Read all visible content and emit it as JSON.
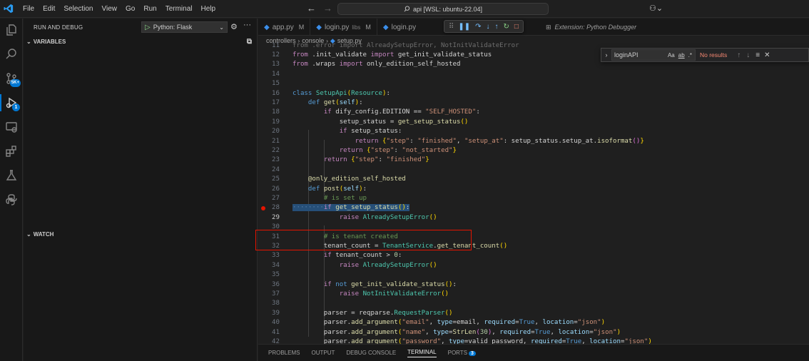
{
  "menu": [
    "File",
    "Edit",
    "Selection",
    "View",
    "Go",
    "Run",
    "Terminal",
    "Help"
  ],
  "command_center": "api [WSL: ubuntu-22.04]",
  "activity_badges": {
    "source_control": "5K+",
    "debug": "1"
  },
  "sidebar": {
    "title": "RUN AND DEBUG",
    "config": "Python: Flask",
    "variables_label": "VARIABLES",
    "watch_label": "WATCH"
  },
  "tabs": [
    {
      "name": "app.py",
      "suffix": "",
      "status": "M"
    },
    {
      "name": "login.py",
      "suffix": "libs",
      "status": "M"
    },
    {
      "name": "login.py",
      "suffix": "",
      "status": ""
    }
  ],
  "extension_tab": "Extension: Python Debugger",
  "breadcrumb": [
    "controllers",
    "console",
    "setup.py"
  ],
  "find": {
    "query": "loginAPI",
    "case_label": "Aa",
    "word_label": "ab",
    "regex_label": ".*",
    "result": "No results"
  },
  "code": {
    "line_numbers": [
      "11",
      "12",
      "13",
      "14",
      "15",
      "16",
      "17",
      "18",
      "19",
      "20",
      "21",
      "22",
      "23",
      "24",
      "25",
      "26",
      "27",
      "28",
      "29",
      "30",
      "31",
      "32",
      "33",
      "34",
      "35",
      "36",
      "37",
      "38",
      "39",
      "40",
      "41",
      "42"
    ],
    "breakpoint_line": "28",
    "current_line": "29"
  },
  "panel": {
    "tabs": [
      "PROBLEMS",
      "OUTPUT",
      "DEBUG CONSOLE",
      "TERMINAL",
      "PORTS"
    ],
    "active": "TERMINAL",
    "ports_badge": "3"
  }
}
